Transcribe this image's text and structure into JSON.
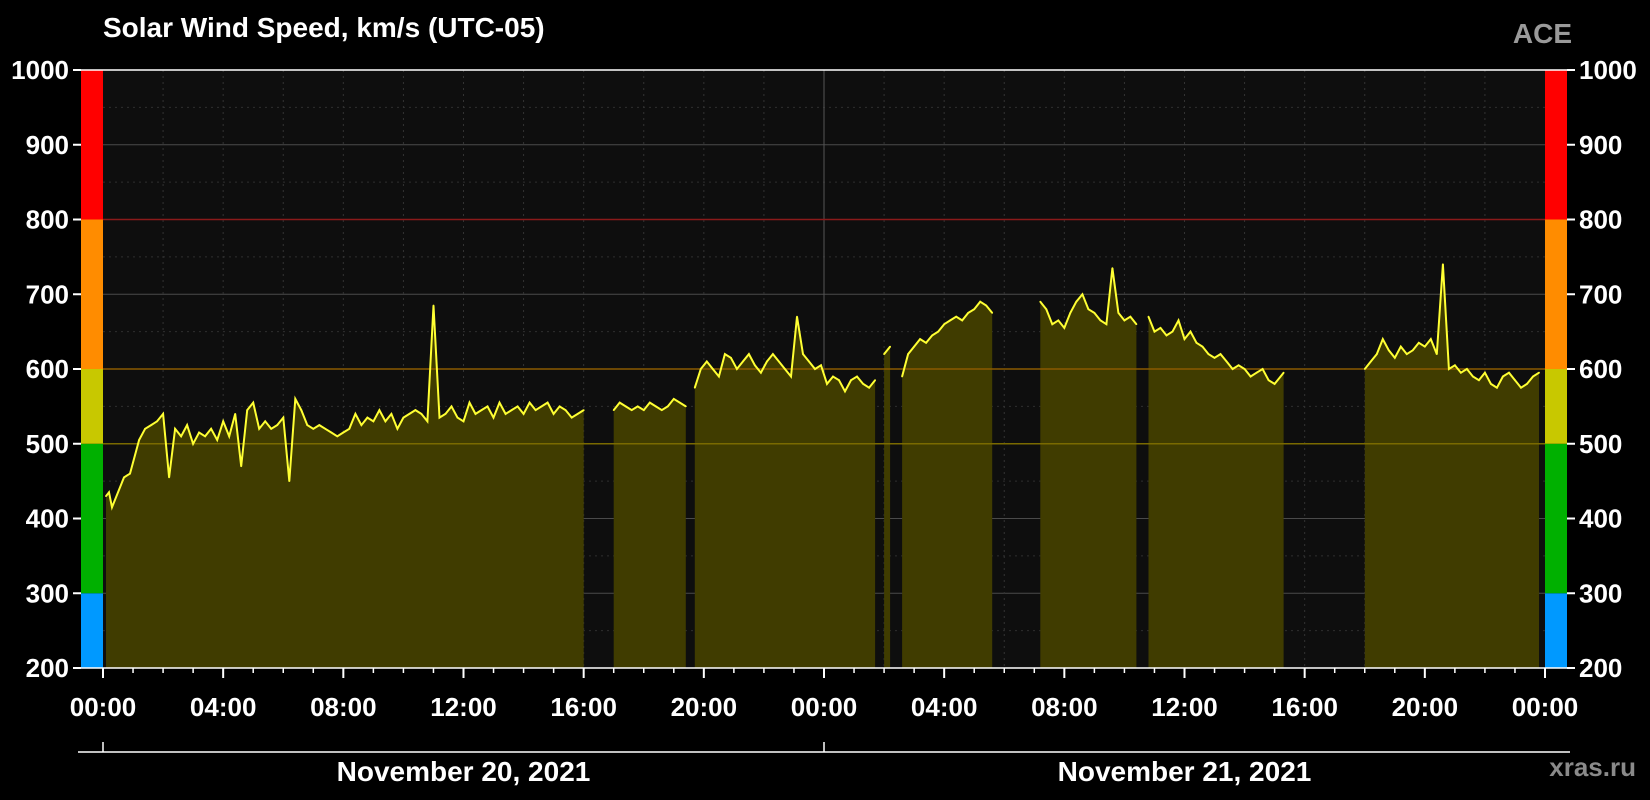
{
  "header": {
    "title": "Solar Wind Speed, km/s (UTC-05)",
    "source": "ACE"
  },
  "footer": {
    "credit": "xras.ru"
  },
  "colors": {
    "background": "#000000",
    "plot_background": "#0e0e0e",
    "line": "#ffff33",
    "fill": "#403c00",
    "scale_bands": [
      {
        "from": 200,
        "to": 300,
        "color": "#0099ff"
      },
      {
        "from": 300,
        "to": 500,
        "color": "#00b000"
      },
      {
        "from": 500,
        "to": 600,
        "color": "#c8c800"
      },
      {
        "from": 600,
        "to": 800,
        "color": "#ff8c00"
      },
      {
        "from": 800,
        "to": 1000,
        "color": "#ff0000"
      }
    ],
    "threshold_lines": [
      {
        "value": 500,
        "color": "#7a6a00"
      },
      {
        "value": 600,
        "color": "#8a5a00"
      },
      {
        "value": 800,
        "color": "#8a1a1a"
      }
    ]
  },
  "chart_data": {
    "type": "area",
    "title": "Solar Wind Speed, km/s (UTC-05)",
    "xlabel": "",
    "ylabel": "",
    "ylim": [
      200,
      1000
    ],
    "xlim_hours": [
      0,
      48
    ],
    "yticks": [
      200,
      300,
      400,
      500,
      600,
      700,
      800,
      900,
      1000
    ],
    "xtick_labels": [
      "00:00",
      "04:00",
      "08:00",
      "12:00",
      "16:00",
      "20:00",
      "00:00",
      "04:00",
      "08:00",
      "12:00",
      "16:00",
      "20:00",
      "00:00"
    ],
    "date_labels": [
      "November 20, 2021",
      "November 21, 2021"
    ],
    "grid": true,
    "gaps_hours": [
      [
        2.3,
        2.3
      ],
      [
        16.0,
        17.0
      ],
      [
        19.4,
        19.7
      ],
      [
        25.8,
        26.0
      ],
      [
        26.4,
        26.6
      ],
      [
        29.6,
        31.2
      ],
      [
        34.4,
        34.8
      ],
      [
        36.8,
        36.9
      ],
      [
        37.6,
        37.8
      ],
      [
        39.3,
        42.0
      ],
      [
        47.9,
        48.0
      ]
    ],
    "series": [
      {
        "x_hours": [
          0.1,
          0.2,
          0.3,
          0.7,
          0.9,
          1.2,
          1.4,
          1.6,
          1.8,
          2.0,
          2.2,
          2.4,
          2.6,
          2.8,
          3.0,
          3.2,
          3.4,
          3.6,
          3.8,
          4.0,
          4.2,
          4.4,
          4.6,
          4.8,
          5.0,
          5.2,
          5.4,
          5.6,
          5.8,
          6.0,
          6.2,
          6.4,
          6.6,
          6.8,
          7.0,
          7.2,
          7.4,
          7.6,
          7.8,
          8.0,
          8.2,
          8.4,
          8.6,
          8.8,
          9.0,
          9.2,
          9.4,
          9.6,
          9.8,
          10.0,
          10.2,
          10.4,
          10.6,
          10.8,
          11.0,
          11.2,
          11.4,
          11.6,
          11.8,
          12.0,
          12.2,
          12.4,
          12.6,
          12.8,
          13.0,
          13.2,
          13.4,
          13.6,
          13.8,
          14.0,
          14.2,
          14.4,
          14.6,
          14.8,
          15.0,
          15.2,
          15.4,
          15.6,
          15.8,
          16.0,
          17.0,
          17.2,
          17.4,
          17.6,
          17.8,
          18.0,
          18.2,
          18.4,
          18.6,
          18.8,
          19.0,
          19.2,
          19.4,
          19.7,
          19.9,
          20.1,
          20.3,
          20.5,
          20.7,
          20.9,
          21.1,
          21.3,
          21.5,
          21.7,
          21.9,
          22.1,
          22.3,
          22.5,
          22.7,
          22.9,
          23.1,
          23.3,
          23.5,
          23.7,
          23.9,
          24.1,
          24.3,
          24.5,
          24.7,
          24.9,
          25.1,
          25.3,
          25.5,
          25.7,
          26.0,
          26.2,
          26.6,
          26.8,
          27.0,
          27.2,
          27.4,
          27.6,
          27.8,
          28.0,
          28.2,
          28.4,
          28.6,
          28.8,
          29.0,
          29.2,
          29.4,
          29.6,
          31.2,
          31.4,
          31.6,
          31.8,
          32.0,
          32.2,
          32.4,
          32.6,
          32.8,
          33.0,
          33.2,
          33.4,
          33.6,
          33.8,
          34.0,
          34.2,
          34.4,
          34.8,
          35.0,
          35.2,
          35.4,
          35.6,
          35.8,
          36.0,
          36.2,
          36.4,
          36.6,
          36.8,
          37.0,
          37.2,
          37.4,
          37.6,
          37.8,
          38.0,
          38.2,
          38.4,
          38.6,
          38.8,
          39.0,
          39.2,
          39.3,
          42.0,
          42.2,
          42.4,
          42.6,
          42.8,
          43.0,
          43.2,
          43.4,
          43.6,
          43.8,
          44.0,
          44.2,
          44.4,
          44.6,
          44.8,
          45.0,
          45.2,
          45.4,
          45.6,
          45.8,
          46.0,
          46.2,
          46.4,
          46.6,
          46.8,
          47.0,
          47.2,
          47.4,
          47.6,
          47.8
        ],
        "values": [
          430,
          435,
          415,
          455,
          460,
          505,
          520,
          525,
          530,
          540,
          455,
          520,
          510,
          525,
          500,
          515,
          510,
          520,
          505,
          530,
          510,
          540,
          470,
          545,
          555,
          520,
          530,
          520,
          525,
          535,
          450,
          560,
          545,
          525,
          520,
          525,
          520,
          515,
          510,
          515,
          520,
          540,
          525,
          535,
          530,
          545,
          530,
          540,
          520,
          535,
          540,
          545,
          540,
          530,
          685,
          535,
          540,
          550,
          535,
          530,
          555,
          540,
          545,
          550,
          535,
          555,
          540,
          545,
          550,
          540,
          555,
          545,
          550,
          555,
          540,
          550,
          545,
          535,
          540,
          545,
          545,
          555,
          550,
          545,
          550,
          545,
          555,
          550,
          545,
          550,
          560,
          555,
          550,
          575,
          600,
          610,
          600,
          590,
          620,
          615,
          600,
          610,
          620,
          605,
          595,
          610,
          620,
          610,
          600,
          590,
          670,
          620,
          610,
          600,
          605,
          580,
          590,
          585,
          570,
          585,
          590,
          580,
          575,
          585,
          620,
          630,
          590,
          620,
          630,
          640,
          635,
          645,
          650,
          660,
          665,
          670,
          665,
          675,
          680,
          690,
          685,
          675,
          690,
          680,
          660,
          665,
          655,
          675,
          690,
          700,
          680,
          675,
          665,
          660,
          735,
          675,
          665,
          670,
          660,
          670,
          650,
          655,
          645,
          650,
          665,
          640,
          650,
          635,
          630,
          620,
          615,
          620,
          610,
          600,
          605,
          600,
          590,
          595,
          600,
          585,
          580,
          590,
          595,
          600,
          610,
          620,
          640,
          625,
          615,
          630,
          620,
          625,
          635,
          630,
          640,
          620,
          740,
          600,
          605,
          595,
          600,
          590,
          585,
          595,
          580,
          575,
          590,
          595,
          585,
          575,
          580,
          590,
          595,
          590,
          585,
          580,
          575,
          580,
          590,
          585
        ]
      }
    ]
  }
}
